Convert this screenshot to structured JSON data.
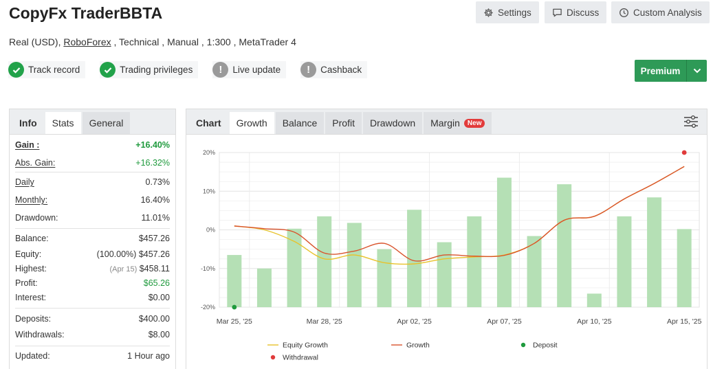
{
  "header": {
    "title": "CopyFx TraderBBTA",
    "subtitle_prefix": "Real (USD), ",
    "broker": "RoboForex",
    "subtitle_suffix": " , Technical , Manual , 1:300 , MetaTrader 4",
    "settings_label": "Settings",
    "discuss_label": "Discuss",
    "analysis_label": "Custom Analysis"
  },
  "badges": [
    {
      "label": "Track record",
      "status": "check-icon"
    },
    {
      "label": "Trading privileges",
      "status": "check-icon"
    },
    {
      "label": "Live update",
      "status": "warning-icon"
    },
    {
      "label": "Cashback",
      "status": "warning-icon"
    }
  ],
  "premium": {
    "label": "Premium"
  },
  "left_tabs": {
    "info": "Info",
    "stats": "Stats",
    "general": "General"
  },
  "stats": {
    "gain": {
      "label": "Gain :",
      "value": "+16.40%"
    },
    "abs_gain": {
      "label": "Abs. Gain:",
      "value": "+16.32%"
    },
    "daily": {
      "label": "Daily",
      "value": "0.73%"
    },
    "monthly": {
      "label": "Monthly:",
      "value": "16.40%"
    },
    "drawdown": {
      "label": "Drawdown:",
      "value": "11.01%"
    },
    "balance": {
      "label": "Balance:",
      "value": "$457.26"
    },
    "equity": {
      "label": "Equity:",
      "note": "(100.00%)",
      "value": "$457.26"
    },
    "highest": {
      "label": "Highest:",
      "note": "(Apr 15)",
      "value": "$458.11"
    },
    "profit": {
      "label": "Profit:",
      "value": "$65.26"
    },
    "interest": {
      "label": "Interest:",
      "value": "$0.00"
    },
    "deposits": {
      "label": "Deposits:",
      "value": "$400.00"
    },
    "withdrawals": {
      "label": "Withdrawals:",
      "value": "$8.00"
    },
    "updated": {
      "label": "Updated:",
      "value": "1 Hour ago"
    }
  },
  "chart_tabs": {
    "chart": "Chart",
    "growth": "Growth",
    "balance": "Balance",
    "profit": "Profit",
    "drawdown": "Drawdown",
    "margin": "Margin",
    "new_badge": "New"
  },
  "colors": {
    "bar": "#b5e0b5",
    "equity": "#e8c22a",
    "growth": "#d9532c",
    "deposit": "#1f9a3d",
    "withdrawal": "#e03b3b",
    "primary_green": "#2e9a57"
  },
  "chart_data": {
    "type": "bar",
    "x_tick_labels": [
      "Mar 25, '25",
      "Mar 28, '25",
      "Apr 02, '25",
      "Apr 07, '25",
      "Apr 10, '25",
      "Apr 15, '25"
    ],
    "y_tick_labels": [
      "20%",
      "10%",
      "0%",
      "-10%",
      "-20%"
    ],
    "ylim": [
      -20,
      20
    ],
    "bars": {
      "name": "",
      "values": [
        -6.5,
        -10,
        0.3,
        3.5,
        1.8,
        -5,
        5.2,
        -3.2,
        3.5,
        13.5,
        -1.6,
        11.8,
        -16.5,
        3.5,
        8.4,
        0.2
      ]
    },
    "series": [
      {
        "name": "Equity Growth",
        "values": [
          1,
          0,
          -3,
          -7.5,
          -6.5,
          -8.5,
          -8.8,
          -7.5,
          -7,
          -6.5,
          -3.5,
          2.5,
          3.5,
          8,
          12,
          16.4
        ]
      },
      {
        "name": "Growth",
        "values": [
          1,
          0.3,
          -0.6,
          -6,
          -5.5,
          -3.5,
          -8,
          -6.5,
          -6.8,
          -6.6,
          -3.5,
          2.5,
          3.5,
          8,
          12,
          16.4
        ]
      }
    ],
    "markers": [
      {
        "name": "Deposit",
        "index": 0,
        "value": -20
      },
      {
        "name": "Withdrawal",
        "index": 15,
        "value": 20
      }
    ],
    "legend": [
      "Equity Growth",
      "Growth",
      "Deposit",
      "Withdrawal"
    ],
    "legend_position": "bottom",
    "grid": true
  }
}
